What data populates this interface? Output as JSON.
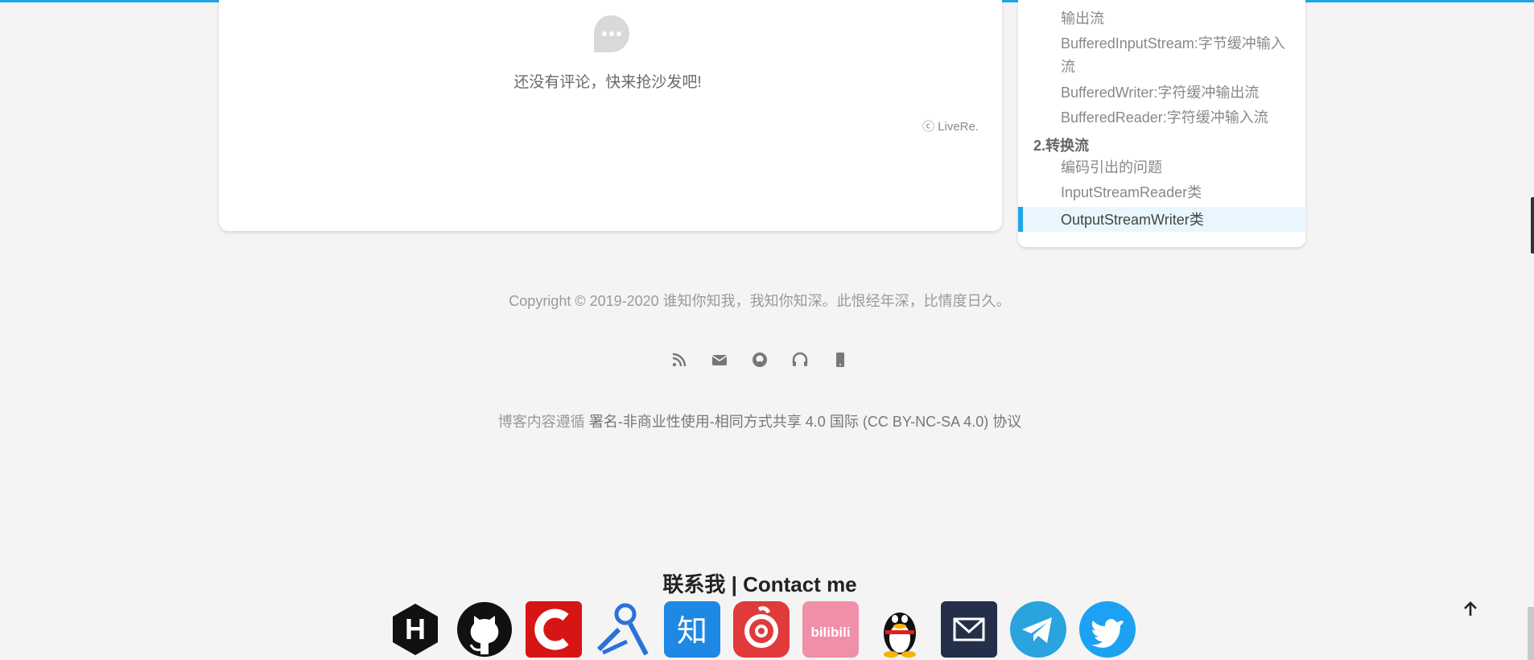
{
  "comments": {
    "empty_message": "还没有评论，快来抢沙发吧!",
    "provider": "ⓒ LiveRe."
  },
  "toc": {
    "items": [
      {
        "text": "输出流",
        "kind": "item"
      },
      {
        "text": "BufferedInputStream:字节缓冲输入",
        "kind": "item"
      },
      {
        "text": "流",
        "kind": "item"
      },
      {
        "text": "BufferedWriter:字符缓冲输出流",
        "kind": "item"
      },
      {
        "text": "BufferedReader:字符缓冲输入流",
        "kind": "item"
      },
      {
        "text": "2.转换流",
        "kind": "heading"
      },
      {
        "text": "编码引出的问题",
        "kind": "item"
      },
      {
        "text": "InputStreamReader类",
        "kind": "item"
      }
    ],
    "active": "OutputStreamWriter类"
  },
  "footer": {
    "copyright": "Copyright © 2019-2020 谁知你知我，我知你知深。此恨经年深，比情度日久。",
    "social_icons": [
      "rss-icon",
      "mail-icon",
      "github-icon",
      "headphones-icon",
      "phone-icon"
    ],
    "license_prefix": "博客内容遵循",
    "license_link": "署名-非商业性使用-相同方式共享 4.0 国际 (CC BY-NC-SA 4.0) 协议",
    "contact_title": "联系我 | Contact me",
    "contact_icons": [
      "hexo-icon",
      "github-icon",
      "csdn-icon",
      "location-icon",
      "zhihu-icon",
      "netease-music-icon",
      "bilibili-icon",
      "qq-icon",
      "email-icon",
      "telegram-icon",
      "twitter-icon"
    ],
    "contact_labels": {
      "hexo": "H",
      "zhihu": "知",
      "bilibili": "bilibili"
    }
  },
  "colors": {
    "accent": "#1ea5e8",
    "background": "#f4f4f4"
  }
}
